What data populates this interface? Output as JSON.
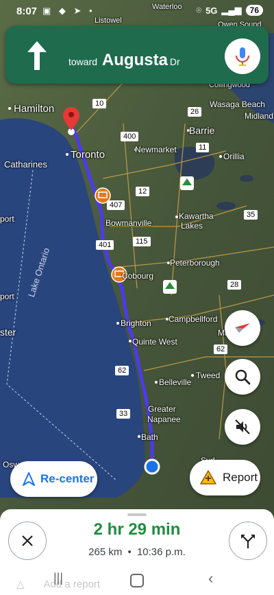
{
  "status": {
    "time": "8:07",
    "network": "5G",
    "battery": "76"
  },
  "nav": {
    "toward": "toward",
    "street": "Augusta",
    "suffix": "Dr",
    "direction": "straight-arrow-icon"
  },
  "map": {
    "places": [
      {
        "name": "Hamilton"
      },
      {
        "name": "Toronto"
      },
      {
        "name": "Catharines"
      },
      {
        "name": "Barrie"
      },
      {
        "name": "Newmarket"
      },
      {
        "name": "Orillia"
      },
      {
        "name": "Wasaga Beach"
      },
      {
        "name": "Midland"
      },
      {
        "name": "Collingwood"
      },
      {
        "name": "Kawartha"
      },
      {
        "name": "Lakes"
      },
      {
        "name": "Bowmanville"
      },
      {
        "name": "Peterborough"
      },
      {
        "name": "Campbellford"
      },
      {
        "name": "Brighton"
      },
      {
        "name": "Quinte West"
      },
      {
        "name": "Belleville"
      },
      {
        "name": "Tweed"
      },
      {
        "name": "Greater"
      },
      {
        "name": "Napanee"
      },
      {
        "name": "Bath"
      },
      {
        "name": "Marmo"
      },
      {
        "name": "port"
      },
      {
        "name": "port"
      },
      {
        "name": "ster"
      },
      {
        "name": "Osw"
      },
      {
        "name": "Syd"
      },
      {
        "name": "Owen Sound"
      },
      {
        "name": "Listowel"
      },
      {
        "name": "Waterloo"
      },
      {
        "name": "Cobourg"
      }
    ],
    "lake_label": "Lake Ontario",
    "shields": [
      "10",
      "400",
      "26",
      "11",
      "12",
      "407",
      "401",
      "115",
      "35",
      "28",
      "62",
      "62",
      "33"
    ]
  },
  "buttons": {
    "recenter": "Re-center",
    "report": "Report"
  },
  "trip": {
    "duration": "2 hr 29 min",
    "distance": "265 km",
    "separator": "•",
    "arrival": "10:36 p.m."
  },
  "peek": {
    "add_report": "Add a report"
  },
  "colors": {
    "nav_green": "#1e6b4e",
    "route": "#4b3bf0",
    "eta_green": "#1e8e3e"
  }
}
